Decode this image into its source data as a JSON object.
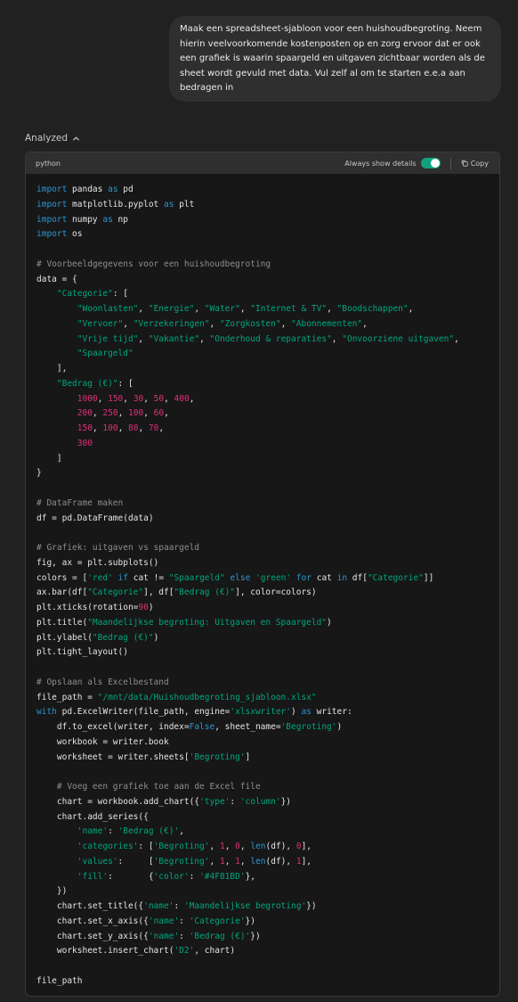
{
  "user_message": "Maak een spreadsheet-sjabloon voor een huishoudbegroting. Neem hierin veelvoorkomende kostenposten op en zorg ervoor dat er ook een grafiek is waarin spaargeld en uitgaven zichtbaar worden als de sheet wordt gevuld met data. Vul zelf al om te starten e.e.a aan bedragen in",
  "analyzed_label": "Analyzed",
  "code_block": {
    "language": "python",
    "always_show_details_label": "Always show details",
    "always_show_details_on": true,
    "copy_label": "Copy",
    "lines": [
      [
        [
          "kw",
          "import"
        ],
        [
          "p",
          " pandas "
        ],
        [
          "kw",
          "as"
        ],
        [
          "p",
          " pd"
        ]
      ],
      [
        [
          "kw",
          "import"
        ],
        [
          "p",
          " matplotlib.pyplot "
        ],
        [
          "kw",
          "as"
        ],
        [
          "p",
          " plt"
        ]
      ],
      [
        [
          "kw",
          "import"
        ],
        [
          "p",
          " numpy "
        ],
        [
          "kw",
          "as"
        ],
        [
          "p",
          " np"
        ]
      ],
      [
        [
          "kw",
          "import"
        ],
        [
          "p",
          " os"
        ]
      ],
      [],
      [
        [
          "cm",
          "# Voorbeeldgegevens voor een huishoudbegroting"
        ]
      ],
      [
        [
          "p",
          "data = {"
        ]
      ],
      [
        [
          "p",
          "    "
        ],
        [
          "str",
          "\"Categorie\""
        ],
        [
          "p",
          ": ["
        ]
      ],
      [
        [
          "p",
          "        "
        ],
        [
          "str",
          "\"Woonlasten\""
        ],
        [
          "p",
          ", "
        ],
        [
          "str",
          "\"Energie\""
        ],
        [
          "p",
          ", "
        ],
        [
          "str",
          "\"Water\""
        ],
        [
          "p",
          ", "
        ],
        [
          "str",
          "\"Internet & TV\""
        ],
        [
          "p",
          ", "
        ],
        [
          "str",
          "\"Boodschappen\""
        ],
        [
          "p",
          ","
        ]
      ],
      [
        [
          "p",
          "        "
        ],
        [
          "str",
          "\"Vervoer\""
        ],
        [
          "p",
          ", "
        ],
        [
          "str",
          "\"Verzekeringen\""
        ],
        [
          "p",
          ", "
        ],
        [
          "str",
          "\"Zorgkosten\""
        ],
        [
          "p",
          ", "
        ],
        [
          "str",
          "\"Abonnementen\""
        ],
        [
          "p",
          ","
        ]
      ],
      [
        [
          "p",
          "        "
        ],
        [
          "str",
          "\"Vrije tijd\""
        ],
        [
          "p",
          ", "
        ],
        [
          "str",
          "\"Vakantie\""
        ],
        [
          "p",
          ", "
        ],
        [
          "str",
          "\"Onderhoud & reparaties\""
        ],
        [
          "p",
          ", "
        ],
        [
          "str",
          "\"Onvoorziene uitgaven\""
        ],
        [
          "p",
          ","
        ]
      ],
      [
        [
          "p",
          "        "
        ],
        [
          "str",
          "\"Spaargeld\""
        ]
      ],
      [
        [
          "p",
          "    ],"
        ]
      ],
      [
        [
          "p",
          "    "
        ],
        [
          "str",
          "\"Bedrag (€)\""
        ],
        [
          "p",
          ": ["
        ]
      ],
      [
        [
          "p",
          "        "
        ],
        [
          "num",
          "1000"
        ],
        [
          "p",
          ", "
        ],
        [
          "num",
          "150"
        ],
        [
          "p",
          ", "
        ],
        [
          "num",
          "30"
        ],
        [
          "p",
          ", "
        ],
        [
          "num",
          "50"
        ],
        [
          "p",
          ", "
        ],
        [
          "num",
          "400"
        ],
        [
          "p",
          ","
        ]
      ],
      [
        [
          "p",
          "        "
        ],
        [
          "num",
          "200"
        ],
        [
          "p",
          ", "
        ],
        [
          "num",
          "250"
        ],
        [
          "p",
          ", "
        ],
        [
          "num",
          "100"
        ],
        [
          "p",
          ", "
        ],
        [
          "num",
          "60"
        ],
        [
          "p",
          ","
        ]
      ],
      [
        [
          "p",
          "        "
        ],
        [
          "num",
          "150"
        ],
        [
          "p",
          ", "
        ],
        [
          "num",
          "100"
        ],
        [
          "p",
          ", "
        ],
        [
          "num",
          "80"
        ],
        [
          "p",
          ", "
        ],
        [
          "num",
          "70"
        ],
        [
          "p",
          ","
        ]
      ],
      [
        [
          "p",
          "        "
        ],
        [
          "num",
          "300"
        ]
      ],
      [
        [
          "p",
          "    ]"
        ]
      ],
      [
        [
          "p",
          "}"
        ]
      ],
      [],
      [
        [
          "cm",
          "# DataFrame maken"
        ]
      ],
      [
        [
          "p",
          "df = pd.DataFrame(data)"
        ]
      ],
      [],
      [
        [
          "cm",
          "# Grafiek: uitgaven vs spaargeld"
        ]
      ],
      [
        [
          "p",
          "fig, ax = plt.subplots()"
        ]
      ],
      [
        [
          "p",
          "colors = ["
        ],
        [
          "str",
          "'red'"
        ],
        [
          "p",
          " "
        ],
        [
          "kw",
          "if"
        ],
        [
          "p",
          " cat != "
        ],
        [
          "str",
          "\"Spaargeld\""
        ],
        [
          "p",
          " "
        ],
        [
          "kw",
          "else"
        ],
        [
          "p",
          " "
        ],
        [
          "str",
          "'green'"
        ],
        [
          "p",
          " "
        ],
        [
          "kw",
          "for"
        ],
        [
          "p",
          " cat "
        ],
        [
          "kw",
          "in"
        ],
        [
          "p",
          " df["
        ],
        [
          "str",
          "\"Categorie\""
        ],
        [
          "p",
          "]]"
        ]
      ],
      [
        [
          "p",
          "ax.bar(df["
        ],
        [
          "str",
          "\"Categorie\""
        ],
        [
          "p",
          "], df["
        ],
        [
          "str",
          "\"Bedrag (€)\""
        ],
        [
          "p",
          "], color=colors)"
        ]
      ],
      [
        [
          "p",
          "plt.xticks(rotation="
        ],
        [
          "num",
          "90"
        ],
        [
          "p",
          ")"
        ]
      ],
      [
        [
          "p",
          "plt.title("
        ],
        [
          "str",
          "\"Maandelijkse begroting: Uitgaven en Spaargeld\""
        ],
        [
          "p",
          ")"
        ]
      ],
      [
        [
          "p",
          "plt.ylabel("
        ],
        [
          "str",
          "\"Bedrag (€)\""
        ],
        [
          "p",
          ")"
        ]
      ],
      [
        [
          "p",
          "plt.tight_layout()"
        ]
      ],
      [],
      [
        [
          "cm",
          "# Opslaan als Excelbestand"
        ]
      ],
      [
        [
          "p",
          "file_path = "
        ],
        [
          "str",
          "\"/mnt/data/Huishoudbegroting_sjabloon.xlsx\""
        ]
      ],
      [
        [
          "kw",
          "with"
        ],
        [
          "p",
          " pd.ExcelWriter(file_path, engine="
        ],
        [
          "str",
          "'xlsxwriter'"
        ],
        [
          "p",
          ") "
        ],
        [
          "kw",
          "as"
        ],
        [
          "p",
          " writer:"
        ]
      ],
      [
        [
          "p",
          "    df.to_excel(writer, index="
        ],
        [
          "kw",
          "False"
        ],
        [
          "p",
          ", sheet_name="
        ],
        [
          "str",
          "'Begroting'"
        ],
        [
          "p",
          ")"
        ]
      ],
      [
        [
          "p",
          "    workbook = writer.book"
        ]
      ],
      [
        [
          "p",
          "    worksheet = writer.sheets["
        ],
        [
          "str",
          "'Begroting'"
        ],
        [
          "p",
          "]"
        ]
      ],
      [],
      [
        [
          "p",
          "    "
        ],
        [
          "cm",
          "# Voeg een grafiek toe aan de Excel file"
        ]
      ],
      [
        [
          "p",
          "    chart = workbook.add_chart({"
        ],
        [
          "str",
          "'type'"
        ],
        [
          "p",
          ": "
        ],
        [
          "str",
          "'column'"
        ],
        [
          "p",
          "})"
        ]
      ],
      [
        [
          "p",
          "    chart.add_series({"
        ]
      ],
      [
        [
          "p",
          "        "
        ],
        [
          "str",
          "'name'"
        ],
        [
          "p",
          ": "
        ],
        [
          "str",
          "'Bedrag (€)'"
        ],
        [
          "p",
          ","
        ]
      ],
      [
        [
          "p",
          "        "
        ],
        [
          "str",
          "'categories'"
        ],
        [
          "p",
          ": ["
        ],
        [
          "str",
          "'Begroting'"
        ],
        [
          "p",
          ", "
        ],
        [
          "num",
          "1"
        ],
        [
          "p",
          ", "
        ],
        [
          "num",
          "0"
        ],
        [
          "p",
          ", "
        ],
        [
          "kw",
          "len"
        ],
        [
          "p",
          "(df), "
        ],
        [
          "num",
          "0"
        ],
        [
          "p",
          "],"
        ]
      ],
      [
        [
          "p",
          "        "
        ],
        [
          "str",
          "'values'"
        ],
        [
          "p",
          ":     ["
        ],
        [
          "str",
          "'Begroting'"
        ],
        [
          "p",
          ", "
        ],
        [
          "num",
          "1"
        ],
        [
          "p",
          ", "
        ],
        [
          "num",
          "1"
        ],
        [
          "p",
          ", "
        ],
        [
          "kw",
          "len"
        ],
        [
          "p",
          "(df), "
        ],
        [
          "num",
          "1"
        ],
        [
          "p",
          "],"
        ]
      ],
      [
        [
          "p",
          "        "
        ],
        [
          "str",
          "'fill'"
        ],
        [
          "p",
          ":       {"
        ],
        [
          "str",
          "'color'"
        ],
        [
          "p",
          ": "
        ],
        [
          "str",
          "'#4F81BD'"
        ],
        [
          "p",
          "},"
        ]
      ],
      [
        [
          "p",
          "    })"
        ]
      ],
      [
        [
          "p",
          "    chart.set_title({"
        ],
        [
          "str",
          "'name'"
        ],
        [
          "p",
          ": "
        ],
        [
          "str",
          "'Maandelijkse begroting'"
        ],
        [
          "p",
          "})"
        ]
      ],
      [
        [
          "p",
          "    chart.set_x_axis({"
        ],
        [
          "str",
          "'name'"
        ],
        [
          "p",
          ": "
        ],
        [
          "str",
          "'Categorie'"
        ],
        [
          "p",
          "})"
        ]
      ],
      [
        [
          "p",
          "    chart.set_y_axis({"
        ],
        [
          "str",
          "'name'"
        ],
        [
          "p",
          ": "
        ],
        [
          "str",
          "'Bedrag (€)'"
        ],
        [
          "p",
          "})"
        ]
      ],
      [
        [
          "p",
          "    worksheet.insert_chart("
        ],
        [
          "str",
          "'D2'"
        ],
        [
          "p",
          ", chart)"
        ]
      ],
      [],
      [
        [
          "p",
          "file_path"
        ]
      ]
    ]
  }
}
